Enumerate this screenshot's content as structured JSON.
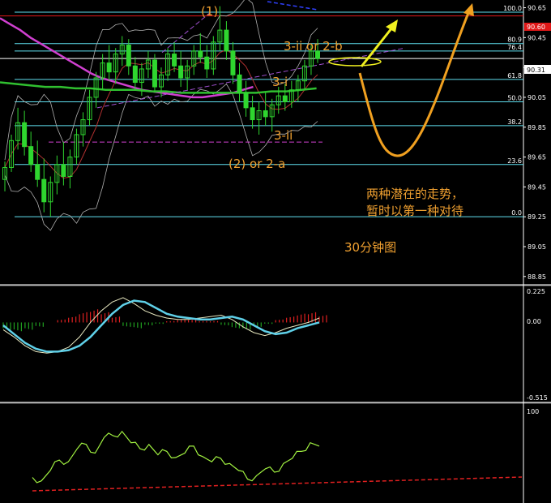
{
  "chart_data": [
    {
      "type": "candlestick",
      "panel": "price-30min",
      "title": "30分钟图",
      "y_ticks": [
        "90.65",
        "90.45",
        "90.25",
        "90.05",
        "89.85",
        "89.65",
        "89.45",
        "89.25",
        "89.05",
        "88.85"
      ],
      "ylim": [
        88.8,
        90.68
      ],
      "current_price": "90.31",
      "red_level_label": "90.60",
      "fib_levels": [
        {
          "label": "100.0",
          "value": 90.62
        },
        {
          "label": "80.9",
          "value": 90.41
        },
        {
          "label": "76.4",
          "value": 90.36
        },
        {
          "label": "61.8",
          "value": 90.17
        },
        {
          "label": "50.0",
          "value": 90.02
        },
        {
          "label": "38.2",
          "value": 89.86
        },
        {
          "label": "23.6",
          "value": 89.6
        },
        {
          "label": "0.0",
          "value": 89.25
        }
      ],
      "annotations": {
        "wave_1": "(1)",
        "wave_2": "(2) or 2-a",
        "wave_3i": "3-i",
        "wave_3ii": "3-ii",
        "wave_3ii_or_2b": "3-ii or 2-b",
        "note_line1": "两种潜在的走势，",
        "note_line2": "暂时以第一种对待"
      },
      "candles": [
        [
          89.5,
          89.62,
          89.42,
          89.58
        ],
        [
          89.58,
          89.8,
          89.55,
          89.76
        ],
        [
          89.76,
          89.98,
          89.7,
          89.88
        ],
        [
          89.88,
          89.96,
          89.66,
          89.72
        ],
        [
          89.72,
          89.82,
          89.55,
          89.6
        ],
        [
          89.6,
          89.76,
          89.45,
          89.5
        ],
        [
          89.5,
          89.64,
          89.28,
          89.35
        ],
        [
          89.35,
          89.52,
          89.25,
          89.48
        ],
        [
          89.48,
          89.66,
          89.4,
          89.6
        ],
        [
          89.6,
          89.75,
          89.46,
          89.52
        ],
        [
          89.52,
          89.7,
          89.44,
          89.65
        ],
        [
          89.65,
          89.84,
          89.6,
          89.8
        ],
        [
          89.8,
          89.95,
          89.72,
          89.9
        ],
        [
          89.9,
          90.1,
          89.86,
          90.05
        ],
        [
          90.05,
          90.22,
          89.98,
          90.18
        ],
        [
          90.18,
          90.34,
          90.1,
          90.28
        ],
        [
          90.28,
          90.4,
          90.16,
          90.22
        ],
        [
          90.22,
          90.38,
          90.14,
          90.34
        ],
        [
          90.34,
          90.46,
          90.26,
          90.4
        ],
        [
          90.4,
          90.44,
          90.2,
          90.26
        ],
        [
          90.26,
          90.32,
          90.1,
          90.15
        ],
        [
          90.15,
          90.28,
          90.06,
          90.24
        ],
        [
          90.24,
          90.36,
          90.18,
          90.3
        ],
        [
          90.3,
          90.34,
          90.08,
          90.12
        ],
        [
          90.12,
          90.25,
          90.05,
          90.2
        ],
        [
          90.2,
          90.38,
          90.16,
          90.34
        ],
        [
          90.34,
          90.42,
          90.22,
          90.26
        ],
        [
          90.26,
          90.36,
          90.12,
          90.18
        ],
        [
          90.18,
          90.3,
          90.1,
          90.26
        ],
        [
          90.26,
          90.4,
          90.2,
          90.36
        ],
        [
          90.36,
          90.48,
          90.28,
          90.32
        ],
        [
          90.32,
          90.4,
          90.18,
          90.24
        ],
        [
          90.24,
          90.46,
          90.2,
          90.42
        ],
        [
          90.42,
          90.66,
          90.36,
          90.5
        ],
        [
          90.5,
          90.56,
          90.3,
          90.36
        ],
        [
          90.36,
          90.42,
          90.14,
          90.2
        ],
        [
          90.2,
          90.28,
          90.02,
          90.08
        ],
        [
          90.08,
          90.16,
          89.92,
          89.98
        ],
        [
          89.98,
          90.06,
          89.84,
          89.9
        ],
        [
          89.9,
          90.02,
          89.8,
          89.96
        ],
        [
          89.96,
          90.08,
          89.86,
          89.92
        ],
        [
          89.92,
          90.04,
          89.82,
          90.0
        ],
        [
          90.0,
          90.12,
          89.94,
          90.06
        ],
        [
          90.06,
          90.14,
          89.96,
          90.02
        ],
        [
          90.02,
          90.16,
          89.98,
          90.1
        ],
        [
          90.1,
          90.2,
          90.02,
          90.16
        ],
        [
          90.16,
          90.3,
          90.1,
          90.26
        ],
        [
          90.26,
          90.4,
          90.2,
          90.36
        ],
        [
          90.36,
          90.44,
          90.28,
          90.31
        ]
      ]
    },
    {
      "type": "line",
      "panel": "macd",
      "y_ticks": [
        "0.225",
        "0.00",
        "-0.515"
      ],
      "ylim": [
        -0.515,
        0.225
      ],
      "series": [
        {
          "values": [
            -0.02,
            -0.08,
            -0.14,
            -0.18,
            -0.2,
            -0.2,
            -0.19,
            -0.16,
            -0.1,
            -0.02,
            0.06,
            0.12,
            0.15,
            0.14,
            0.1,
            0.06,
            0.04,
            0.03,
            0.02,
            0.02,
            0.03,
            0.04,
            0.02,
            -0.02,
            -0.06,
            -0.08,
            -0.07,
            -0.04,
            -0.02,
            0.0
          ]
        },
        {
          "values": [
            -0.05,
            -0.1,
            -0.16,
            -0.2,
            -0.21,
            -0.2,
            -0.17,
            -0.1,
            0.0,
            0.08,
            0.14,
            0.17,
            0.13,
            0.08,
            0.05,
            0.03,
            0.02,
            0.02,
            0.03,
            0.04,
            0.05,
            0.02,
            -0.03,
            -0.07,
            -0.09,
            -0.07,
            -0.04,
            -0.02,
            0.0,
            0.03
          ]
        }
      ],
      "histogram": [
        -0.05,
        -0.06,
        -0.05,
        -0.03,
        0.0,
        0.02,
        0.04,
        0.07,
        0.09,
        0.07,
        0.04,
        -0.03,
        -0.04,
        -0.02,
        -0.01,
        0.01,
        0.02,
        0.02,
        0.01,
        0.01,
        -0.02,
        -0.04,
        -0.05,
        -0.03,
        -0.01,
        0.02,
        0.04,
        0.06,
        0.07,
        0.05
      ]
    },
    {
      "type": "line",
      "panel": "oscillator",
      "y_ticks": [
        "100"
      ],
      "ylim": [
        0,
        100
      ],
      "series": [
        {
          "values": [
            22,
            18,
            30,
            42,
            40,
            55,
            60,
            50,
            68,
            70,
            75,
            62,
            55,
            60,
            48,
            52,
            45,
            50,
            58,
            46,
            40,
            44,
            38,
            30,
            20,
            24,
            32,
            28,
            38,
            44,
            52,
            62,
            58
          ]
        }
      ]
    }
  ],
  "colors": {
    "candle": "#2fd62f",
    "fib_line": "#5fe0f0",
    "red_level": "#e01818",
    "current_price_box": "#ffffff",
    "wave_text": "#f0a030",
    "macd_line1": "#5fd0e8",
    "macd_line2": "#e8e8c0",
    "oscillator": "#a0f040",
    "trend_dashed_red": "#e02020",
    "magenta_ma": "#d040d0",
    "green_ma": "#30c030",
    "bollinger": "#b0b0b0",
    "arrow_yellow": "#f0f020",
    "arrow_orange": "#f0a020"
  }
}
